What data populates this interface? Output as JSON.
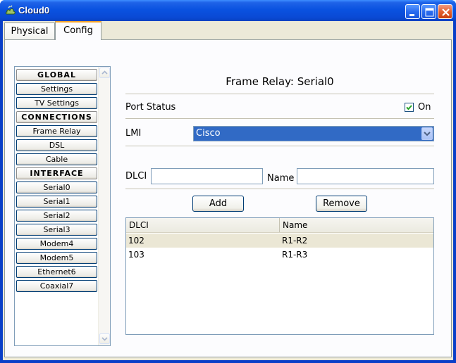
{
  "window": {
    "title": "Cloud0"
  },
  "tabs": [
    {
      "label": "Physical",
      "active": false
    },
    {
      "label": "Config",
      "active": true
    }
  ],
  "sidebar": {
    "items": [
      {
        "label": "GLOBAL",
        "kind": "header"
      },
      {
        "label": "Settings",
        "kind": "button"
      },
      {
        "label": "TV Settings",
        "kind": "button"
      },
      {
        "label": "CONNECTIONS",
        "kind": "header"
      },
      {
        "label": "Frame Relay",
        "kind": "button"
      },
      {
        "label": "DSL",
        "kind": "button"
      },
      {
        "label": "Cable",
        "kind": "button"
      },
      {
        "label": "INTERFACE",
        "kind": "header"
      },
      {
        "label": "Serial0",
        "kind": "button"
      },
      {
        "label": "Serial1",
        "kind": "button"
      },
      {
        "label": "Serial2",
        "kind": "button"
      },
      {
        "label": "Serial3",
        "kind": "button"
      },
      {
        "label": "Modem4",
        "kind": "button"
      },
      {
        "label": "Modem5",
        "kind": "button"
      },
      {
        "label": "Ethernet6",
        "kind": "button"
      },
      {
        "label": "Coaxial7",
        "kind": "button"
      }
    ]
  },
  "main": {
    "title": "Frame Relay: Serial0",
    "port_status_label": "Port Status",
    "port_status_on_label": "On",
    "port_status_checked": true,
    "lmi_label": "LMI",
    "lmi_value": "Cisco",
    "dlci_label": "DLCI",
    "dlci_value": "",
    "name_label": "Name",
    "name_value": "",
    "add_label": "Add",
    "remove_label": "Remove",
    "table": {
      "columns": [
        "DLCI",
        "Name"
      ],
      "rows": [
        {
          "dlci": "102",
          "name": "R1-R2",
          "selected": true
        },
        {
          "dlci": "103",
          "name": "R1-R3",
          "selected": false
        }
      ]
    }
  },
  "colors": {
    "titlebar": "#0a52e0",
    "selection": "#316ac5",
    "client_bg": "#ece9d8",
    "tab_accent": "#f4a52d"
  }
}
